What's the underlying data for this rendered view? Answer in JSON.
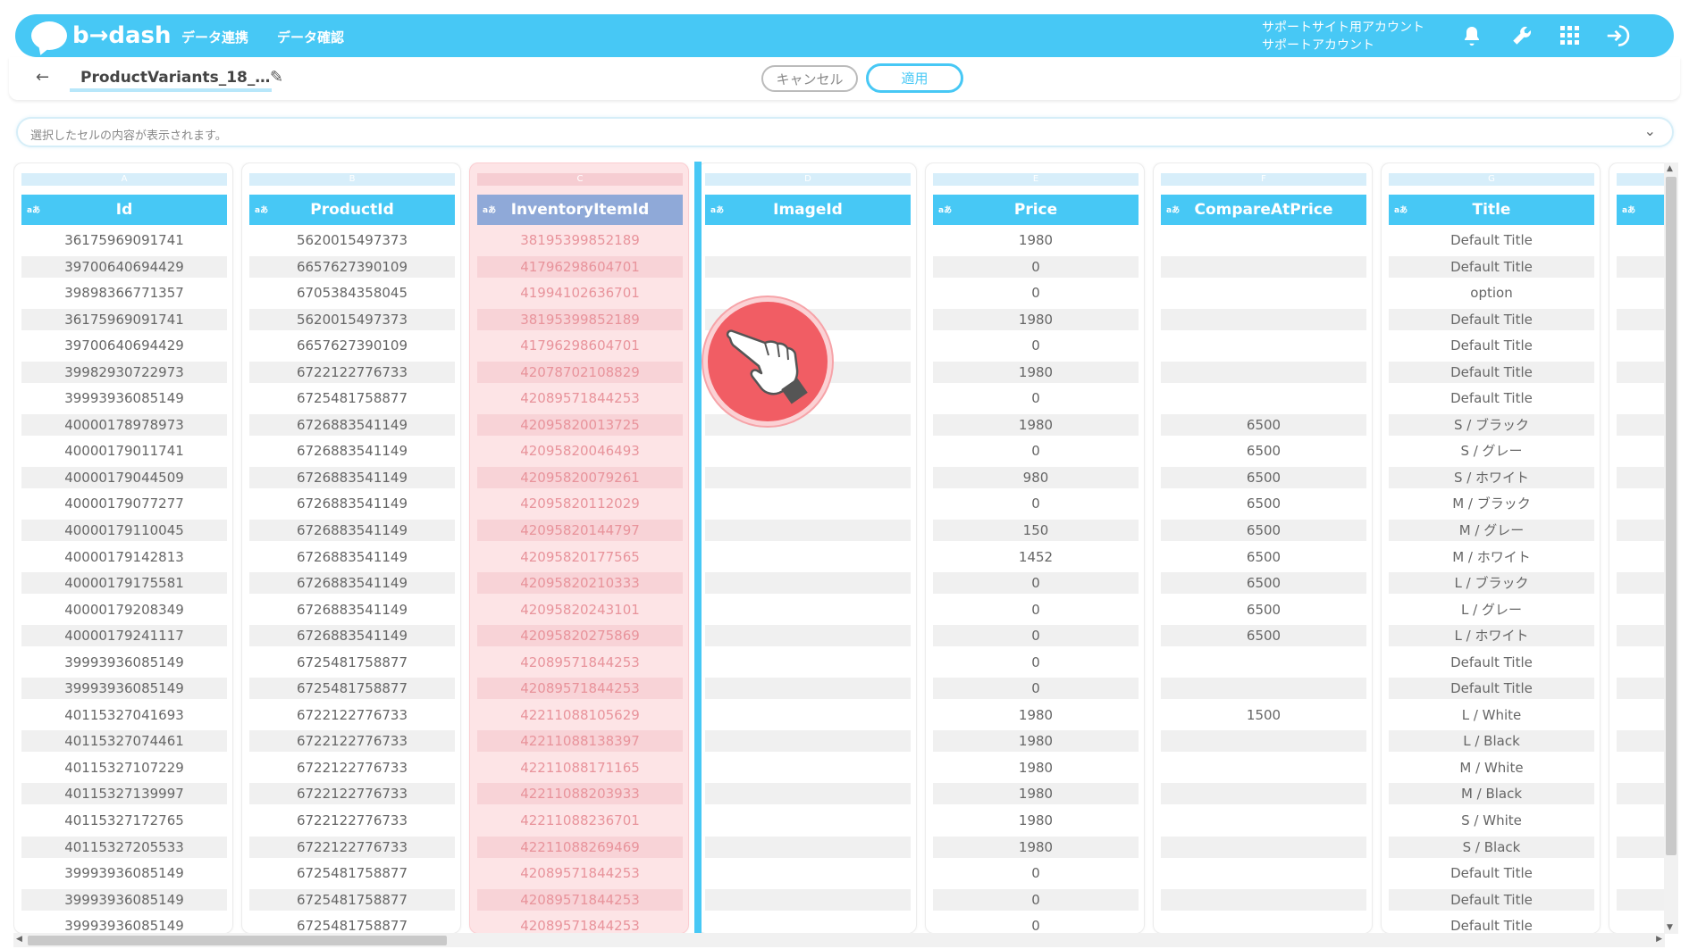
{
  "header": {
    "logo_text": "b→dash",
    "nav": [
      "データ連携",
      "データ確認"
    ],
    "account_line1": "サポートサイト用アカウント",
    "account_line2": "サポートアカウント",
    "icons": [
      "bell-icon",
      "wrench-icon",
      "grid-icon",
      "logout-icon"
    ]
  },
  "toolbar": {
    "back_label": "←",
    "file_title": "ProductVariants_18_…",
    "edit_label": "✎",
    "cancel_label": "キャンセル",
    "apply_label": "適用"
  },
  "cell_bar": {
    "placeholder": "選択したセルの内容が表示されます。",
    "chevron": "⌄"
  },
  "type_label": "aあ",
  "columns": [
    {
      "letter": "A",
      "name": "Id",
      "cells": [
        "36175969091741",
        "39700640694429",
        "39898366771357",
        "36175969091741",
        "39700640694429",
        "39982930722973",
        "39993936085149",
        "40000178978973",
        "40000179011741",
        "40000179044509",
        "40000179077277",
        "40000179110045",
        "40000179142813",
        "40000179175581",
        "40000179208349",
        "40000179241117",
        "39993936085149",
        "39993936085149",
        "40115327041693",
        "40115327074461",
        "40115327107229",
        "40115327139997",
        "40115327172765",
        "40115327205533",
        "39993936085149",
        "39993936085149",
        "39993936085149"
      ]
    },
    {
      "letter": "B",
      "name": "ProductId",
      "cells": [
        "5620015497373",
        "6657627390109",
        "6705384358045",
        "5620015497373",
        "6657627390109",
        "6722122776733",
        "6725481758877",
        "6726883541149",
        "6726883541149",
        "6726883541149",
        "6726883541149",
        "6726883541149",
        "6726883541149",
        "6726883541149",
        "6726883541149",
        "6726883541149",
        "6725481758877",
        "6725481758877",
        "6722122776733",
        "6722122776733",
        "6722122776733",
        "6722122776733",
        "6722122776733",
        "6722122776733",
        "6725481758877",
        "6725481758877",
        "6725481758877"
      ]
    },
    {
      "letter": "C",
      "name": "InventoryItemId",
      "selected": true,
      "cells": [
        "38195399852189",
        "41796298604701",
        "41994102636701",
        "38195399852189",
        "41796298604701",
        "42078702108829",
        "42089571844253",
        "42095820013725",
        "42095820046493",
        "42095820079261",
        "42095820112029",
        "42095820144797",
        "42095820177565",
        "42095820210333",
        "42095820243101",
        "42095820275869",
        "42089571844253",
        "42089571844253",
        "42211088105629",
        "42211088138397",
        "42211088171165",
        "42211088203933",
        "42211088236701",
        "42211088269469",
        "42089571844253",
        "42089571844253",
        "42089571844253"
      ]
    },
    {
      "letter": "D",
      "name": "ImageId",
      "cells": [
        "",
        "",
        "",
        "",
        "",
        "",
        "",
        "",
        "",
        "",
        "",
        "",
        "",
        "",
        "",
        "",
        "",
        "",
        "",
        "",
        "",
        "",
        "",
        "",
        "",
        "",
        ""
      ]
    },
    {
      "letter": "E",
      "name": "Price",
      "cells": [
        "1980",
        "0",
        "0",
        "1980",
        "0",
        "1980",
        "0",
        "1980",
        "0",
        "980",
        "0",
        "150",
        "1452",
        "0",
        "0",
        "0",
        "0",
        "0",
        "1980",
        "1980",
        "1980",
        "1980",
        "1980",
        "1980",
        "0",
        "0",
        "0"
      ]
    },
    {
      "letter": "F",
      "name": "CompareAtPrice",
      "cells": [
        "",
        "",
        "",
        "",
        "",
        "",
        "",
        "6500",
        "6500",
        "6500",
        "6500",
        "6500",
        "6500",
        "6500",
        "6500",
        "6500",
        "",
        "",
        "1500",
        "",
        "",
        "",
        "",
        "",
        "",
        "",
        ""
      ]
    },
    {
      "letter": "G",
      "name": "Title",
      "cells": [
        "Default Title",
        "Default Title",
        "option",
        "Default Title",
        "Default Title",
        "Default Title",
        "Default Title",
        "S / ブラック",
        "S / グレー",
        "S / ホワイト",
        "M / ブラック",
        "M / グレー",
        "M / ホワイト",
        "L / ブラック",
        "L / グレー",
        "L / ホワイト",
        "Default Title",
        "Default Title",
        "L / White",
        "L / Black",
        "M / White",
        "M / Black",
        "S / White",
        "S / Black",
        "Default Title",
        "Default Title",
        "Default Title"
      ]
    },
    {
      "letter": "H",
      "name": "",
      "cells": [
        "",
        "",
        "",
        "",
        "",
        "",
        "",
        "",
        "",
        "",
        "",
        "",
        "",
        "",
        "",
        "",
        "",
        "",
        "",
        "",
        "",
        "",
        "",
        "",
        "",
        "",
        ""
      ]
    }
  ],
  "scroll": {
    "up": "▲",
    "down": "▼",
    "left": "◀",
    "right": "▶"
  }
}
